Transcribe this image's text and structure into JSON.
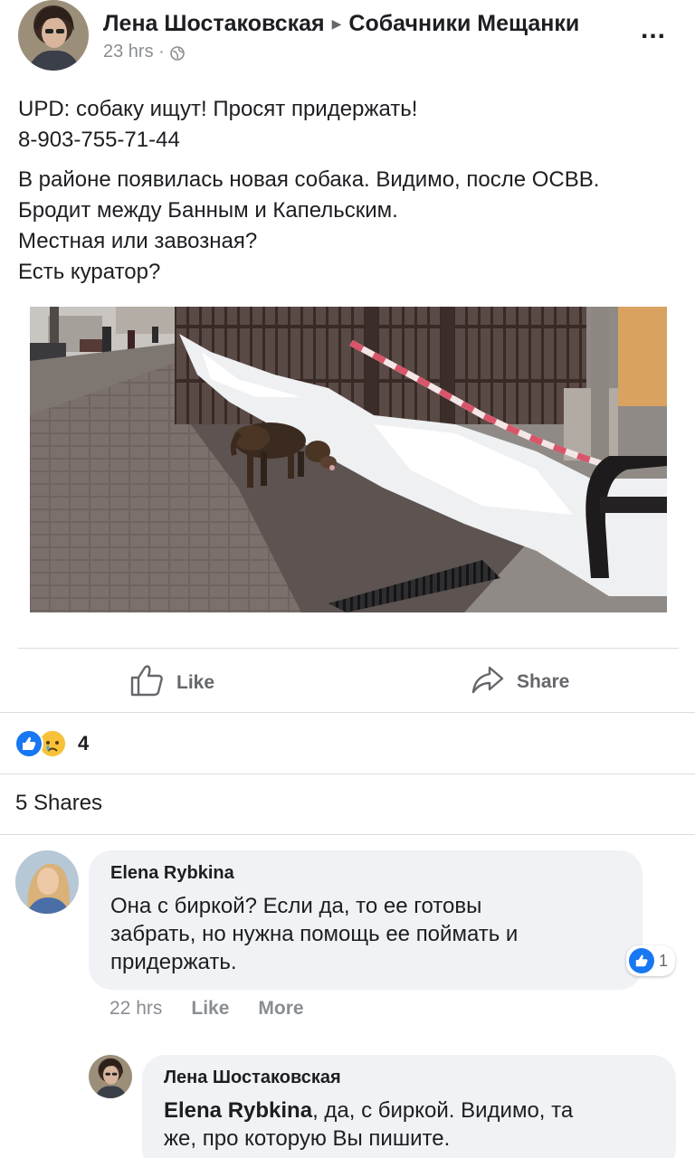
{
  "post": {
    "author": "Лена Шостаковская",
    "group": "Собачники Мещанки",
    "time": "23 hrs ·",
    "more": "...",
    "update_line1": "UPD: собаку ищут! Просят придержать!",
    "update_line2": "8-903-755-71-44",
    "body_line1": "В районе появилась новая собака. Видимо, после ОСВВ.",
    "body_line2": "Бродит между Банным и Капельским.",
    "body_line3": "Местная или завозная?",
    "body_line4": "Есть куратор?"
  },
  "actions": {
    "like": "Like",
    "share": "Share"
  },
  "reactions": {
    "count": "4",
    "types": [
      "like-icon",
      "sad-icon"
    ]
  },
  "shares": "5 Shares",
  "comments": [
    {
      "author": "Elena Rybkina",
      "line1": "Она с биркой? Если да, то ее готовы",
      "line2": "забрать, но нужна помощь ее поймать и",
      "line3": "придержать.",
      "likes": "1",
      "time": "22 hrs",
      "like": "Like",
      "more": "More"
    },
    {
      "author": "Лена Шостаковская",
      "mention": "Elena Rybkina",
      "text1": ", да, с биркой. Видимо, та",
      "line2": "же, про которую Вы пишите."
    }
  ],
  "colors": {
    "accent": "#1877f2",
    "muted": "#65676b",
    "bubble": "#f0f2f5"
  }
}
